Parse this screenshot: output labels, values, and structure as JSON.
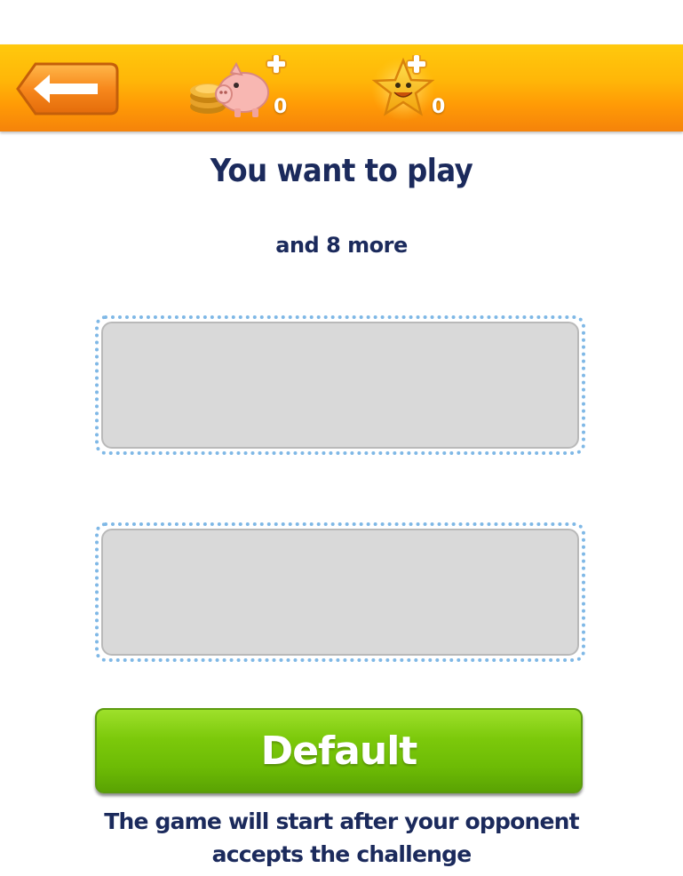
{
  "header": {
    "coins_count": "0",
    "stars_count": "0",
    "icons": {
      "back": "back-arrow-icon",
      "coins": "piggy-bank-coins-plus-icon",
      "stars": "smiling-star-plus-icon"
    },
    "colors": {
      "bar_top": "#ffc90d",
      "bar_bottom": "#f5830a"
    }
  },
  "main": {
    "title": "You want to play",
    "subtitle": "and 8 more",
    "slots": [
      {
        "state": "empty"
      },
      {
        "state": "empty"
      }
    ],
    "default_button_label": "Default",
    "footnote": "The game will start after your opponent accepts the challenge"
  },
  "colors": {
    "text": "#1b2a5c",
    "button_green": "#7cc90b",
    "slot_border": "#7fb8e6",
    "slot_fill": "#d9d9d9"
  }
}
